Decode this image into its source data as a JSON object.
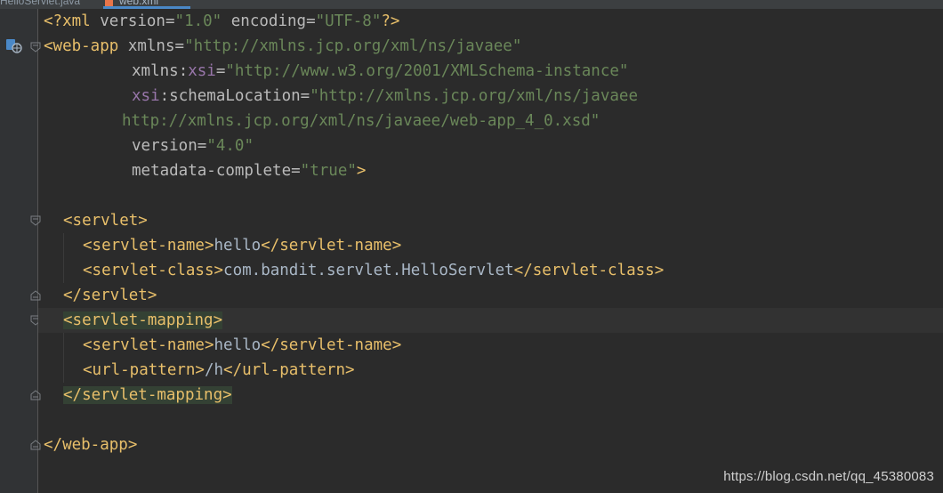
{
  "tabs": [
    {
      "label": "HelloServlet.java",
      "active": false
    },
    {
      "label": "web.xml",
      "active": true
    }
  ],
  "code": {
    "l1": {
      "p1": "<?xml ",
      "a1": "version",
      "e1": "=",
      "v1": "\"1.0\"",
      "s1": " ",
      "a2": "encoding",
      "e2": "=",
      "v2": "\"UTF-8\"",
      "p2": "?>"
    },
    "l2": {
      "t1": "<web-app ",
      "a1": "xmlns",
      "e1": "=",
      "v1": "\"http://xmlns.jcp.org/xml/ns/javaee\""
    },
    "l3": {
      "a1": "xmlns",
      "c1": ":",
      "ns1": "xsi",
      "e1": "=",
      "v1": "\"http://www.w3.org/2001/XMLSchema-instance\""
    },
    "l4": {
      "ns1": "xsi",
      "c1": ":",
      "a1": "schemaLocation",
      "e1": "=",
      "v1": "\"http://xmlns.jcp.org/xml/ns/javaee"
    },
    "l5": {
      "v1": "http://xmlns.jcp.org/xml/ns/javaee/web-app_4_0.xsd\""
    },
    "l6": {
      "a1": "version",
      "e1": "=",
      "v1": "\"4.0\""
    },
    "l7": {
      "a1": "metadata-complete",
      "e1": "=",
      "v1": "\"true\"",
      "t1": ">"
    },
    "l9": {
      "t1": "<servlet>"
    },
    "l10": {
      "t1": "<servlet-name>",
      "x1": "hello",
      "t2": "</servlet-name>"
    },
    "l11": {
      "t1": "<servlet-class>",
      "x1": "com.bandit.servlet.HelloServlet",
      "t2": "</servlet-class>"
    },
    "l12": {
      "t1": "</servlet>"
    },
    "l13": {
      "t1": "<servlet-mapping>"
    },
    "l14": {
      "t1": "<servlet-name>",
      "x1": "hello",
      "t2": "</servlet-name>"
    },
    "l15": {
      "t1": "<url-pattern>",
      "x1": "/h",
      "t2": "</url-pattern>"
    },
    "l16": {
      "t1": "</servlet-mapping>"
    },
    "l18": {
      "t1": "</web-app>"
    }
  },
  "icons": {
    "gutter": "web-descriptor-icon",
    "fold_open": "fold-open-icon",
    "fold_close": "fold-close-icon"
  },
  "colors": {
    "background": "#2b2b2b",
    "tag": "#e8bf6a",
    "attribute": "#bababa",
    "namespace": "#9876aa",
    "value": "#6a8759",
    "text": "#a9b7c6",
    "tag_highlight": "#344134"
  },
  "watermark": "https://blog.csdn.net/qq_45380083"
}
